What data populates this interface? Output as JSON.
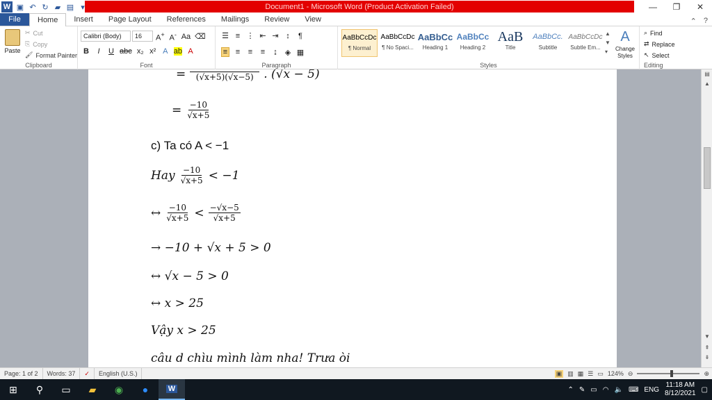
{
  "titlebar": {
    "title": "Document1 - Microsoft Word (Product Activation Failed)",
    "minimize": "—",
    "restore": "❐",
    "close": "✕"
  },
  "menu": {
    "file": "File",
    "tabs": [
      "Home",
      "Insert",
      "Page Layout",
      "References",
      "Mailings",
      "Review",
      "View"
    ]
  },
  "ribbon": {
    "clipboard": {
      "paste": "Paste",
      "cut": "Cut",
      "copy": "Copy",
      "format_painter": "Format Painter",
      "label": "Clipboard"
    },
    "font": {
      "name": "Calibri (Body)",
      "size": "16",
      "label": "Font"
    },
    "paragraph": {
      "label": "Paragraph"
    },
    "styles": {
      "items": [
        {
          "sample": "AaBbCcDc",
          "name": "¶ Normal"
        },
        {
          "sample": "AaBbCcDc",
          "name": "¶ No Spaci..."
        },
        {
          "sample": "AaBbCc",
          "name": "Heading 1"
        },
        {
          "sample": "AaBbCc",
          "name": "Heading 2"
        },
        {
          "sample": "AaB",
          "name": "Title"
        },
        {
          "sample": "AaBbCc.",
          "name": "Subtitle"
        },
        {
          "sample": "AaBbCcDc",
          "name": "Subtle Em..."
        }
      ],
      "change_styles": "Change Styles",
      "label": "Styles"
    },
    "editing": {
      "find": "Find",
      "replace": "Replace",
      "select": "Select",
      "label": "Editing"
    }
  },
  "document": {
    "lines": [
      {
        "kind": "frac_tail",
        "prefix": "=",
        "num": "",
        "den": "(√x+5)(√x−5)",
        "suffix": ". (√x − 5)"
      },
      {
        "kind": "frac",
        "prefix": "=",
        "num": "−10",
        "den": "√x+5",
        "suffix": ""
      },
      {
        "kind": "text",
        "text": "c) Ta có A < −1"
      },
      {
        "kind": "frac",
        "prefix": "Hay",
        "num": "−10",
        "den": "√x+5",
        "suffix": "< −1"
      },
      {
        "kind": "frac2",
        "prefix": "↔",
        "num": "−10",
        "den": "√x+5",
        "mid": "<",
        "num2": "−√x−5",
        "den2": "√x+5"
      },
      {
        "kind": "math",
        "text": "→ −10 + √x + 5 > 0"
      },
      {
        "kind": "math",
        "text": "↔ √x − 5 > 0"
      },
      {
        "kind": "math",
        "text": "↔ x > 25"
      },
      {
        "kind": "math",
        "text": "Vậy x > 25"
      },
      {
        "kind": "math",
        "text": "câu d chìu mình làm nha! Trưa òi"
      }
    ]
  },
  "status": {
    "page": "Page: 1 of 2",
    "words": "Words: 37",
    "language": "English (U.S.)",
    "zoom": "124%"
  },
  "taskbar": {
    "time": "11:18 AM",
    "date": "8/12/2021",
    "lang": "ENG"
  }
}
